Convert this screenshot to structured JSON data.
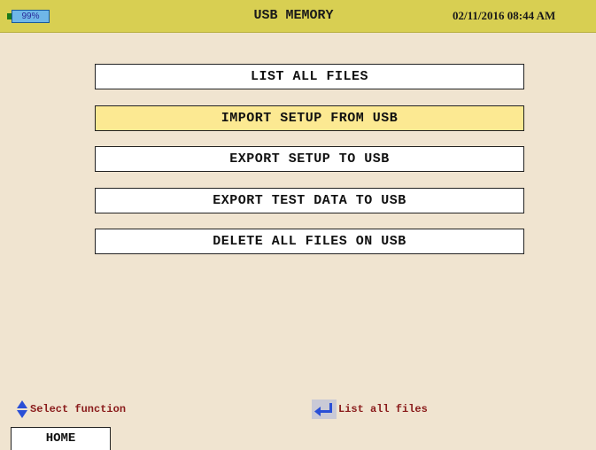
{
  "status_bar": {
    "battery": "99%",
    "title": "USB MEMORY",
    "datetime": "02/11/2016 08:44 AM"
  },
  "menu": {
    "items": [
      {
        "label": "LIST ALL FILES",
        "selected": false
      },
      {
        "label": "IMPORT SETUP FROM USB",
        "selected": true
      },
      {
        "label": "EXPORT SETUP TO USB",
        "selected": false
      },
      {
        "label": "EXPORT TEST DATA TO USB",
        "selected": false
      },
      {
        "label": "DELETE ALL FILES ON USB",
        "selected": false
      }
    ]
  },
  "hints": {
    "select_icon": "up-down-arrows-icon",
    "select_text": "Select function",
    "enter_icon": "enter-return-icon",
    "enter_text": "List all files"
  },
  "tabs": {
    "home_label": "HOME"
  },
  "colors": {
    "background": "#f0e4d0",
    "status_bar": "#d8cf52",
    "selected_item": "#fce992",
    "hint_text": "#8a1b1b"
  }
}
